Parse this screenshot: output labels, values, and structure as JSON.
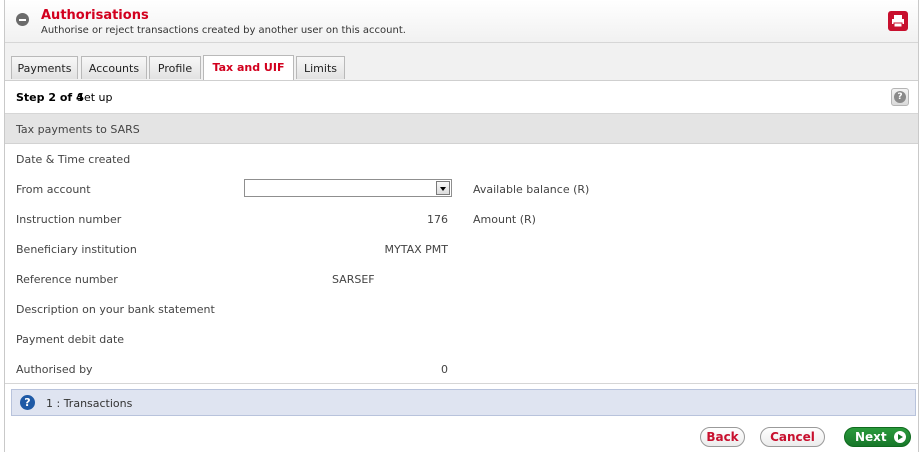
{
  "header": {
    "title": "Authorisations",
    "subtitle": "Authorise or reject transactions created by another user on this account."
  },
  "tabs": [
    {
      "label": "Payments"
    },
    {
      "label": "Accounts"
    },
    {
      "label": "Profile"
    },
    {
      "label": "Tax and UIF",
      "active": true
    },
    {
      "label": "Limits"
    }
  ],
  "step": {
    "strong": "Step 2 of 4",
    "sub": "Set up"
  },
  "section": {
    "title": "Tax payments to SARS"
  },
  "form": {
    "date_label": "Date & Time created",
    "from_label": "From account",
    "from_value": "",
    "instruction_label": "Instruction number",
    "instruction_value": "176",
    "beneficiary_label": "Beneficiary institution",
    "beneficiary_value": "MYTAX PMT",
    "reference_label": "Reference number",
    "reference_value": "SARSEF",
    "description_label": "Description on your bank statement",
    "debit_label": "Payment debit date",
    "authorised_label": "Authorised by",
    "authorised_value": "0",
    "available_label": "Available balance (R)",
    "amount_label": "Amount (R)"
  },
  "info": {
    "text": "1 : Transactions"
  },
  "buttons": {
    "back": "Back",
    "cancel": "Cancel",
    "next": "Next"
  },
  "colors": {
    "brand_red": "#d2001e",
    "next_green": "#17772a",
    "info_blue": "#1f5aa6"
  },
  "icons": [
    "collapse-icon",
    "printer-icon",
    "help-icon",
    "info-icon",
    "next-arrow-icon",
    "chevron-down-icon"
  ]
}
